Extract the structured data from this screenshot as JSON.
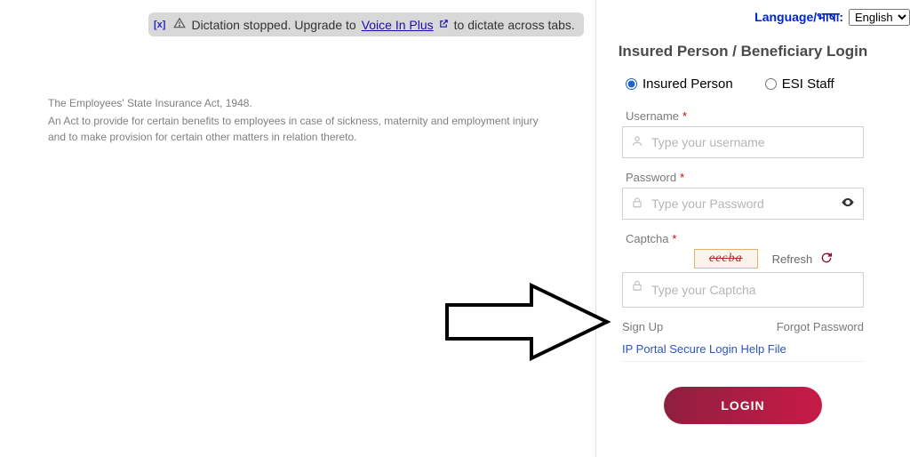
{
  "banner": {
    "close_x": "[x]",
    "text_before": "Dictation stopped. Upgrade to",
    "link_text": "Voice In Plus",
    "text_after": "to dictate across tabs."
  },
  "language": {
    "label": "Language/भाषा:",
    "selected": "English"
  },
  "left": {
    "act_title": "The Employees' State Insurance Act, 1948.",
    "act_body": "An Act to provide for certain benefits to employees in case of sickness, maternity and employment injury and to make provision for certain other matters in relation thereto."
  },
  "login": {
    "title": "Insured Person / Beneficiary Login",
    "radio1": "Insured Person",
    "radio2": "ESI Staff",
    "username_label": "Username",
    "username_placeholder": "Type your username",
    "password_label": "Password",
    "password_placeholder": "Type your Password",
    "captcha_label": "Captcha",
    "captcha_value": "eecba",
    "refresh_text": "Refresh",
    "captcha_placeholder": "Type your Captcha",
    "signup": "Sign Up",
    "forgot": "Forgot Password",
    "help_link": "IP Portal Secure Login Help File",
    "login_btn": "LOGIN"
  }
}
